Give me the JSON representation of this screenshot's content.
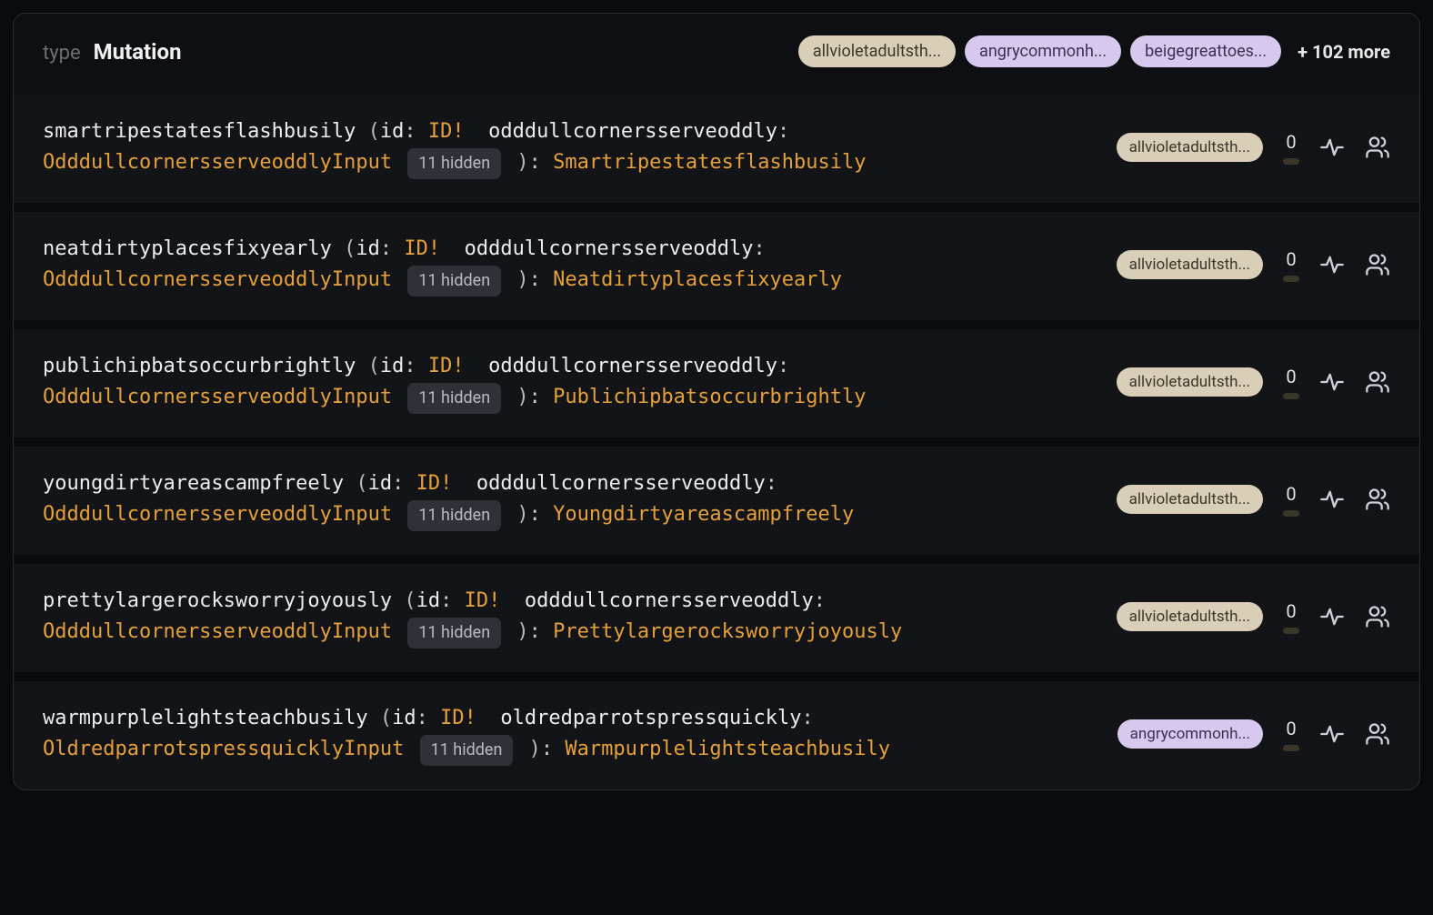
{
  "header": {
    "type_label": "type",
    "type_name": "Mutation",
    "pills": [
      {
        "text": "allvioletadultsth...",
        "variant": "beige"
      },
      {
        "text": "angrycommonh...",
        "variant": "lilac"
      },
      {
        "text": "beigegreattoes...",
        "variant": "lilac"
      }
    ],
    "more_count": "+ 102 more"
  },
  "rows": [
    {
      "fn": "smartripestatesflashbusily",
      "id_type": "ID!",
      "arg2_label": "odddullcornersserveoddly",
      "arg2_type": "OdddullcornersserveoddlyInput",
      "hidden": "11 hidden",
      "return_type": "Smartripestatesflashbusily",
      "tag": {
        "text": "allvioletadultsth...",
        "variant": "beige"
      },
      "count": "0"
    },
    {
      "fn": "neatdirtyplacesfixyearly",
      "id_type": "ID!",
      "arg2_label": "odddullcornersserveoddly",
      "arg2_type": "OdddullcornersserveoddlyInput",
      "hidden": "11 hidden",
      "return_type": "Neatdirtyplacesfixyearly",
      "tag": {
        "text": "allvioletadultsth...",
        "variant": "beige"
      },
      "count": "0"
    },
    {
      "fn": "publichipbatsoccurbrightly",
      "id_type": "ID!",
      "arg2_label": "odddullcornersserveoddly",
      "arg2_type": "OdddullcornersserveoddlyInput",
      "hidden": "11 hidden",
      "return_type": "Publichipbatsoccurbrightly",
      "tag": {
        "text": "allvioletadultsth...",
        "variant": "beige"
      },
      "count": "0"
    },
    {
      "fn": "youngdirtyareascampfreely",
      "id_type": "ID!",
      "arg2_label": "odddullcornersserveoddly",
      "arg2_type": "OdddullcornersserveoddlyInput",
      "hidden": "11 hidden",
      "return_type": "Youngdirtyareascampfreely",
      "tag": {
        "text": "allvioletadultsth...",
        "variant": "beige"
      },
      "count": "0"
    },
    {
      "fn": "prettylargerocksworryjoyously",
      "id_type": "ID!",
      "arg2_label": "odddullcornersserveoddly",
      "arg2_type": "OdddullcornersserveoddlyInput",
      "hidden": "11 hidden",
      "return_type": "Prettylargerocksworryjoyously",
      "tag": {
        "text": "allvioletadultsth...",
        "variant": "beige"
      },
      "count": "0"
    },
    {
      "fn": "warmpurplelightsteachbusily",
      "id_type": "ID!",
      "arg2_label": "oldredparrotspressquickly",
      "arg2_type": "OldredparrotspressquicklyInput",
      "hidden": "11 hidden",
      "return_type": "Warmpurplelightsteachbusily",
      "tag": {
        "text": "angrycommonh...",
        "variant": "lilac"
      },
      "count": "0"
    }
  ]
}
